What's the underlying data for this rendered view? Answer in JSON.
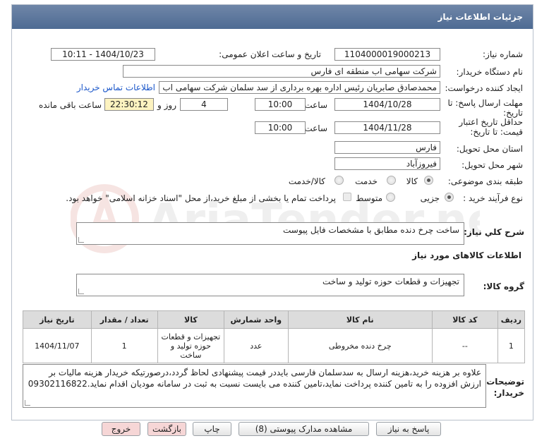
{
  "header": {
    "title": "جزئیات اطلاعات نیاز"
  },
  "form": {
    "need_number": {
      "label": "شماره نیاز:",
      "value": "1104000019000213"
    },
    "announce_datetime": {
      "label": "تاریخ و ساعت اعلان عمومی:",
      "value": "1404/10/23 - 10:11"
    },
    "buyer_org": {
      "label": "نام دستگاه خریدار:",
      "value": "شرکت سهامی اب منطقه ای فارس"
    },
    "requester": {
      "label": "ایجاد کننده درخواست:",
      "value": "محمدصادق صابریان رئیس اداره بهره برداری از سد سلمان شرکت سهامی اب منطقه",
      "contact_link": "اطلاعات تماس خریدار"
    },
    "reply_deadline": {
      "label_line1": "مهلت ارسال پاسخ: تا",
      "label_line2": "تاریخ:",
      "date": "1404/10/28",
      "time_label": "ساعت",
      "time": "10:00",
      "days": "4",
      "days_label": "روز و",
      "remaining": "22:30:12",
      "remaining_label": "ساعت باقی مانده"
    },
    "price_validity": {
      "label_line1": "حداقل تاریخ اعتبار",
      "label_line2": "قیمت: تا تاریخ:",
      "date": "1404/11/28",
      "time_label": "ساعت",
      "time": "10:00"
    },
    "delivery_province": {
      "label": "استان محل تحویل:",
      "value": "فارس"
    },
    "delivery_city": {
      "label": "شهر محل تحویل:",
      "value": "فیروزآباد"
    },
    "category": {
      "label": "طبقه بندی موضوعی:",
      "options": [
        "کالا",
        "خدمت",
        "کالا/خدمت"
      ],
      "selected": "کالا"
    },
    "process_type": {
      "label": "نوع فرآیند خرید :",
      "options": [
        "جزیی",
        "متوسط"
      ],
      "selected": "جزیی",
      "treasury_note": "پرداخت تمام یا بخشی از مبلغ خرید،از محل \"اسناد خزانه اسلامی\" خواهد بود."
    }
  },
  "description": {
    "label": "شرح کلي نياز:",
    "value": "ساخت چرخ دنده مطابق با مشخصات فایل پیوست"
  },
  "goods_section": {
    "title": "اطلاعات کالاهای مورد نیاز"
  },
  "goods_group": {
    "label": "گروه کالا:",
    "value": "تجهیزات و قطعات حوزه تولید و ساخت"
  },
  "table": {
    "headers": [
      "ردیف",
      "کد کالا",
      "نام کالا",
      "واحد شمارش",
      "کالا",
      "تعداد / مقدار",
      "تاریخ نیاز"
    ],
    "rows": [
      [
        "1",
        "--",
        "چرخ دنده مخروطی",
        "عدد",
        "تجهیزات و قطعات حوزه تولید و ساخت",
        "1",
        "1404/11/07"
      ]
    ]
  },
  "buyer_notes": {
    "label": "توضیحات خریدار:",
    "value": "علاوه بر هزینه خرید،هزینه ارسال به سدسلمان فارسی بایددر قیمت پیشنهادی لحاظ گردد،درصورتیکه خریدار هزینه مالیات بر ارزش افزوده را به تامین کننده پرداخت نماید،تامین کننده می بایست نسبت به ثبت در سامانه مودیان اقدام نماید.09302116822"
  },
  "buttons": {
    "reply": "پاسخ به نیاز",
    "view_docs": "مشاهده مدارک پیوستی (8)",
    "print": "چاپ",
    "back": "بازگشت",
    "exit": "خروج"
  },
  "watermark": {
    "text": "AriaTender.net"
  },
  "colors": {
    "header_bg": "#5b769c",
    "link": "#1a56c9",
    "highlight": "#fdf3c0",
    "exit_bg": "#f6d6d6"
  }
}
